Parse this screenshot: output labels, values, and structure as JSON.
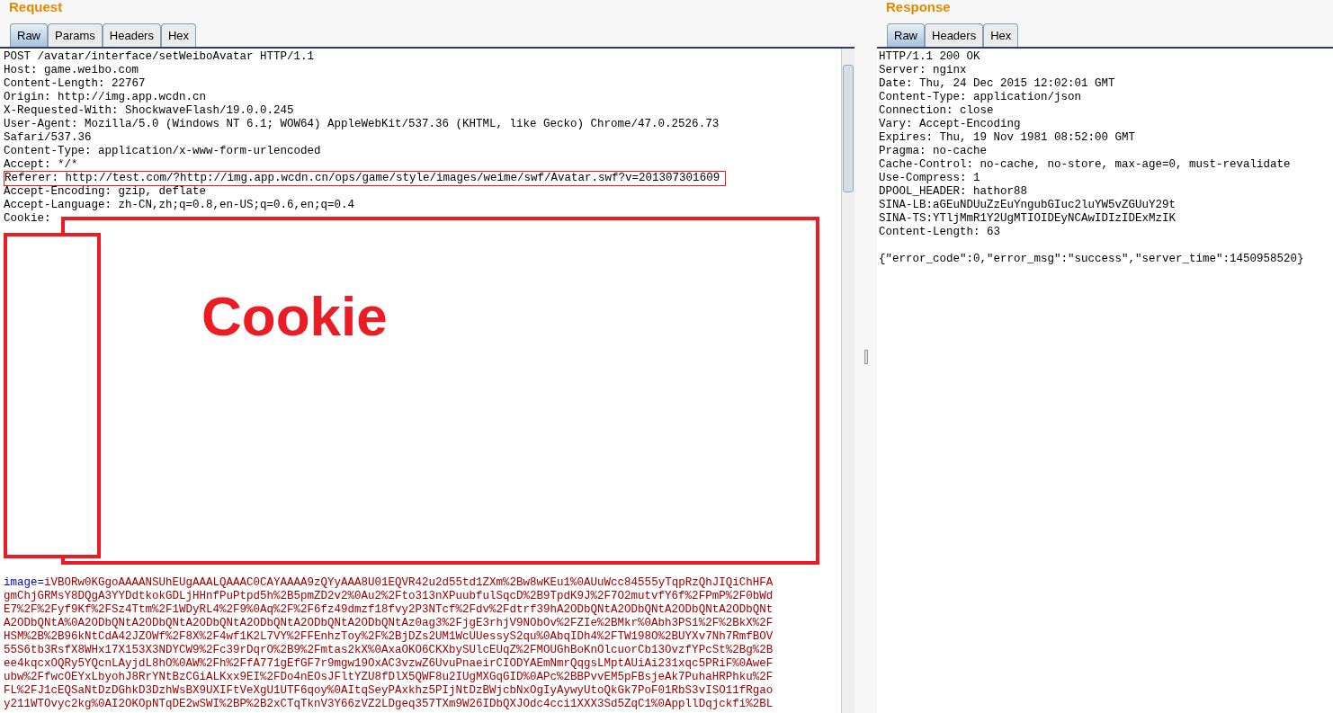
{
  "request": {
    "title": "Request",
    "tabs": [
      {
        "label": "Raw",
        "selected": true
      },
      {
        "label": "Params",
        "selected": false
      },
      {
        "label": "Headers",
        "selected": false
      },
      {
        "label": "Hex",
        "selected": false
      }
    ],
    "headers": [
      {
        "text": "POST /avatar/interface/setWeiboAvatar HTTP/1.1",
        "highlighted": false
      },
      {
        "text": "Host: game.weibo.com",
        "highlighted": false
      },
      {
        "text": "Content-Length: 22767",
        "highlighted": false
      },
      {
        "text": "Origin: http://img.app.wcdn.cn",
        "highlighted": false
      },
      {
        "text": "X-Requested-With: ShockwaveFlash/19.0.0.245",
        "highlighted": false
      },
      {
        "text": "User-Agent: Mozilla/5.0 (Windows NT 6.1; WOW64) AppleWebKit/537.36 (KHTML, like Gecko) Chrome/47.0.2526.73",
        "highlighted": false
      },
      {
        "text": "Safari/537.36",
        "highlighted": false
      },
      {
        "text": "Content-Type: application/x-www-form-urlencoded",
        "highlighted": false
      },
      {
        "text": "Accept: */*",
        "highlighted": false
      },
      {
        "text": "Referer: http://test.com/?http://img.app.wcdn.cn/ops/game/style/images/weime/swf/Avatar.swf?v=201307301609",
        "highlighted": true
      },
      {
        "text": "Accept-Encoding: gzip, deflate",
        "highlighted": false
      },
      {
        "text": "Accept-Language: zh-CN,zh;q=0.8,en-US;q=0.6,en;q=0.4",
        "highlighted": false
      },
      {
        "text": "Cookie:",
        "highlighted": false
      }
    ],
    "redaction": {
      "label": "Cookie"
    },
    "body": {
      "name": "image=",
      "lines": [
        "iVBORw0KGgoAAAANSUhEUgAAALQAAAC0CAYAAAA9zQYyAAA8U01EQVR42u2d55td1ZXm%2Bw8wKEu1%0AUuWcc84555yTqpRzQhJIQiChHFA",
        "gmChjGRMsY8DQgA3YYDdtkokGDLjHHnfPuPtpd5h%2B5pmZD2v2%0Au2%2Fto313nXPuubfulSqcD%2B9TpdK9J%2F7O2mutvfY6f%2FPmP%2F0bWd",
        "E7%2F%2Fyf9Kf%2FSz4Ttm%2F1WDyRL4%2F9%0Aq%2F%2F6fz49dmzf18fvy2P3NTcf%2Fdv%2Fdtrf39hA2ODbQNtA2ODbQNtA2ODbQNtA2ODbQNt",
        "A2ODbQNtA%0A2ODbQNtA2ODbQNtA2ODbQNtA2ODbQNtA2ODbQNtA2ODbQNtAz0ag3%2FjgE3rhjV9NObOv%2FZIe%2BMkr%0Abh3PS1%2F%2BkX%2F",
        "HSM%2B%2B96kNtCdA42JZOWf%2F8X%2F4wf1K2L7VY%2FFEnhzToy%2F%2BjDZs2UM1WcUUessyS2qu%0AbqIDh4%2FTW198O%2BUYXv7Nh7RmfBOV",
        "55S6tb3RsfX8WHx17X153X3NDYCW9%2Fc39rDqrO%2B9%2Fmtas2kX%0AxaOKO6CKXbySUlcEUqZ%2FMOUGhBoKnOlcuorCb13OvzfYPcSt%2Bg%2B",
        "ee4kqcxOQRy5YQcnLAyjdL8hO%0AW%2Fh%2FfA771gEfGF7r9mgw19OxAC3vzwZ6UvuPnaeirCIODYAEmNmrQqgsLMptAUiAi231xqc5PRiF%0AweF",
        "ubw%2FfwcOEYxLbyohJ8RrYNtBzCGiALKxx9EI%2FDo4nEOsJFltYZU8fDlX5QWF8u2IUgMXGqGID%0APc%2BBPvvEM5pFBsjeAk7PuhaHRPhku%2F",
        "FL%2FJ1cEQSaNtDzDGhkD3DzhWsBX9UXIFtVeXgU1UTF6qoy%0AItqSeyPAxkhz5PIjNtDzBWjcbNxOgIyAywyUtoQkGk7PoF01RbS3vISO11fRgao",
        "y211WTOvyc2kg%0AI2OKOpNTqDE2wSWI%2BP%2B2xCTqTknV3Y66zVZ2LDgeq357TXm9W26IDbQXJOdc4cci1XXX3Sd5ZqC1%0AppllDqjckfi%2BL"
      ]
    }
  },
  "response": {
    "title": "Response",
    "tabs": [
      {
        "label": "Raw",
        "selected": true
      },
      {
        "label": "Headers",
        "selected": false
      },
      {
        "label": "Hex",
        "selected": false
      }
    ],
    "lines": [
      "HTTP/1.1 200 OK",
      "Server: nginx",
      "Date: Thu, 24 Dec 2015 12:02:01 GMT",
      "Content-Type: application/json",
      "Connection: close",
      "Vary: Accept-Encoding",
      "Expires: Thu, 19 Nov 1981 08:52:00 GMT",
      "Pragma: no-cache",
      "Cache-Control: no-cache, no-store, max-age=0, must-revalidate",
      "Use-Compress: 1",
      "DPOOL_HEADER: hathor88",
      "SINA-LB:aGEuNDUuZzEuYngubGIuc2luYW5vZGUuY29t",
      "SINA-TS:YTljMmR1Y2UgMTIOIDEyNCAwIDIzIDExMzIK",
      "Content-Length: 63"
    ],
    "body": "{\"error_code\":0,\"error_msg\":\"success\",\"server_time\":1450958520}"
  }
}
